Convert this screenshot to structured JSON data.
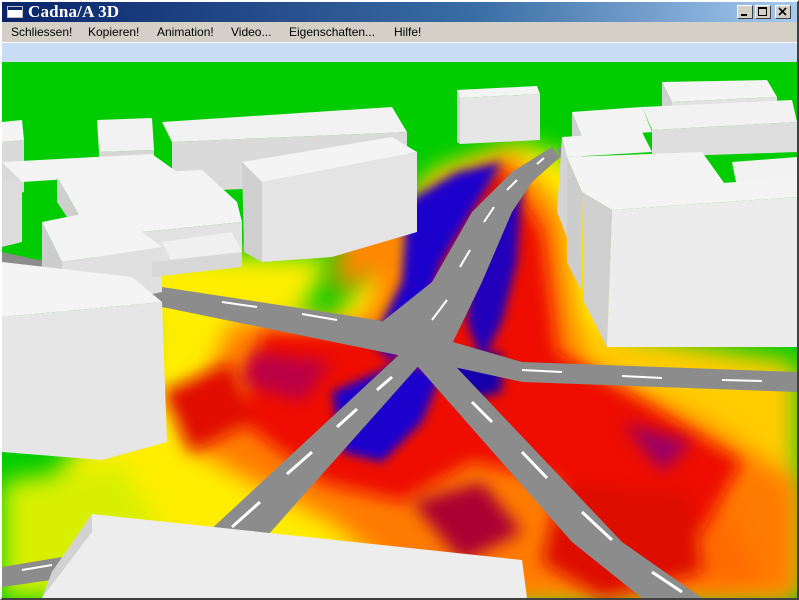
{
  "window": {
    "title": "Cadna/A 3D",
    "icons": {
      "app": "app-window-icon",
      "minimize": "minimize-icon",
      "maximize": "maximize-icon",
      "close": "close-icon"
    }
  },
  "menu": {
    "close": "Schliessen!",
    "copy": "Kopieren!",
    "animation": "Animation!",
    "video": "Video...",
    "properties": "Eigenschaften...",
    "help": "Hilfe!"
  },
  "colors": {
    "titlebar_start": "#0a246a",
    "titlebar_end": "#a6caf0",
    "ground": "#00cc00",
    "road": "#8c8c8c",
    "road_marking": "#ffffff",
    "building_top": "#f2f2f2",
    "building_side": "#d6d6d6",
    "noise_low": "#00cc00",
    "noise_mid": "#ffff00",
    "noise_high": "#ff0000",
    "noise_very_high": "#0000cc"
  }
}
